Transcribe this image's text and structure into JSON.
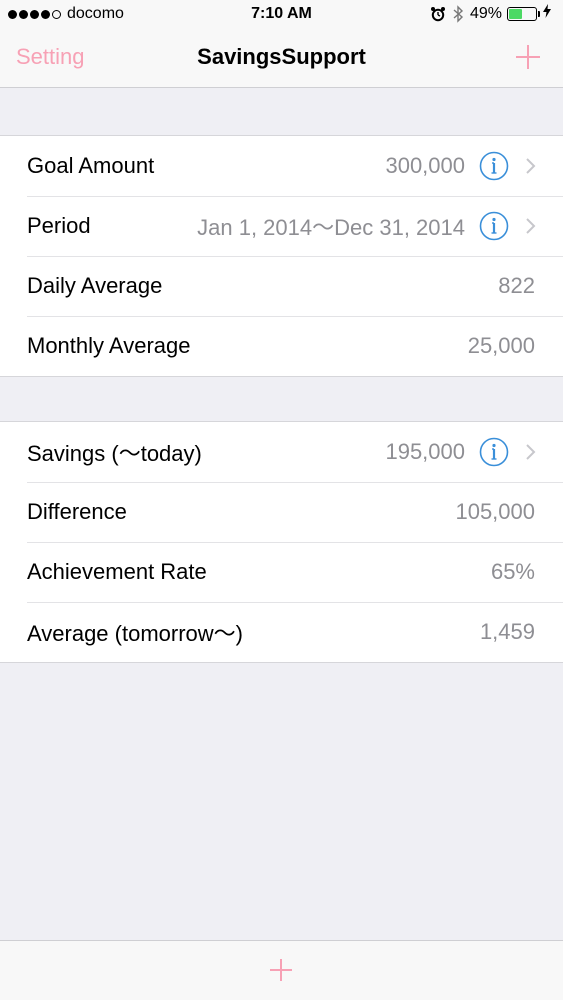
{
  "status_bar": {
    "carrier": "docomo",
    "time": "7:10 AM",
    "battery": "49%",
    "battery_level": 0.49,
    "icons": [
      "alarm-clock-icon",
      "bluetooth-icon",
      "battery-icon",
      "charging-bolt-icon"
    ]
  },
  "nav": {
    "left_label": "Setting",
    "title": "SavingsSupport",
    "right_icon": "plus-icon"
  },
  "sections": [
    {
      "rows": [
        {
          "label": "Goal Amount",
          "value": "300,000",
          "info": true
        },
        {
          "label": "Period",
          "value": "Jan 1, 2014～Dec 31, 2014",
          "info": true
        },
        {
          "label": "Daily Average",
          "value": "822",
          "info": false
        },
        {
          "label": "Monthly Average",
          "value": "25,000",
          "info": false
        }
      ]
    },
    {
      "rows": [
        {
          "label": "Savings (～today)",
          "value": "195,000",
          "info": true
        },
        {
          "label": "Difference",
          "value": "105,000",
          "info": false
        },
        {
          "label": "Achievement Rate",
          "value": "65%",
          "info": false
        },
        {
          "label": "Average (tomorrow～)",
          "value": "1,459",
          "info": false
        }
      ]
    }
  ],
  "toolbar": {
    "icon": "plus-icon"
  },
  "colors": {
    "accent_pink": "#f7a1b5",
    "info_blue": "#3a8fd9",
    "value_gray": "#8e8e93",
    "background": "#efeff4",
    "battery_green": "#4cd964"
  }
}
